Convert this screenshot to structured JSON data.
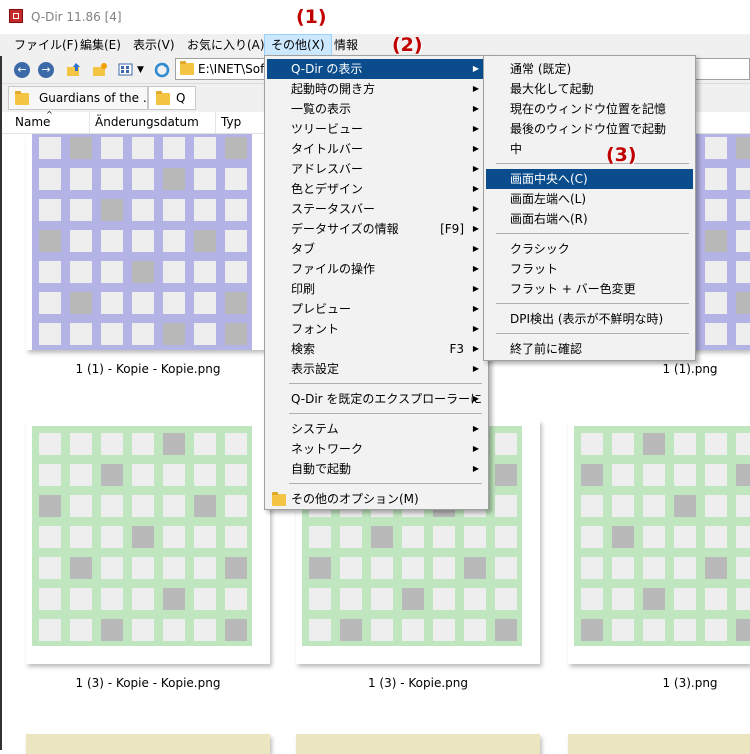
{
  "window": {
    "title": "Q-Dir 11.86 [4]"
  },
  "menubar": [
    {
      "label": "ファイル(F)"
    },
    {
      "label": "編集(E)"
    },
    {
      "label": "表示(V)"
    },
    {
      "label": "お気に入り(A)"
    },
    {
      "label": "その他(X)",
      "active": true
    },
    {
      "label": "情報"
    }
  ],
  "toolbar": {
    "address": "E:\\INET\\Soft"
  },
  "tabs": [
    {
      "label": "Guardians of the ..."
    },
    {
      "label": "Q"
    }
  ],
  "columns": [
    {
      "label": "Name"
    },
    {
      "label": "Änderungsdatum"
    },
    {
      "label": "Typ"
    }
  ],
  "files": [
    {
      "caption": "1 (1) - Kopie - Kopie.png",
      "color": "#b3b3e6"
    },
    {
      "caption": "1 (1).png",
      "color": "#b3b3e6"
    },
    {
      "caption": "1 (3) - Kopie - Kopie.png",
      "color": "#bfe6bf"
    },
    {
      "caption": "1 (3) - Kopie.png",
      "color": "#bfe6bf"
    },
    {
      "caption": "1 (3).png",
      "color": "#bfe6bf"
    }
  ],
  "main_menu": [
    {
      "label": "Q-Dir の表示",
      "submenu": true,
      "highlight": true
    },
    {
      "label": "起動時の開き方",
      "submenu": true
    },
    {
      "label": "一覧の表示",
      "submenu": true
    },
    {
      "label": "ツリービュー",
      "submenu": true
    },
    {
      "label": "タイトルバー",
      "submenu": true
    },
    {
      "label": "アドレスバー",
      "submenu": true
    },
    {
      "label": "色とデザイン",
      "submenu": true
    },
    {
      "label": "ステータスバー",
      "submenu": true
    },
    {
      "label": "データサイズの情報",
      "shortcut": "[F9]",
      "submenu": true
    },
    {
      "label": "タブ",
      "submenu": true
    },
    {
      "label": "ファイルの操作",
      "submenu": true
    },
    {
      "label": "印刷",
      "submenu": true
    },
    {
      "label": "プレビュー",
      "submenu": true
    },
    {
      "label": "フォント",
      "submenu": true
    },
    {
      "label": "検索",
      "shortcut": "F3",
      "submenu": true
    },
    {
      "label": "表示設定",
      "submenu": true
    },
    {
      "label": "Q-Dir を既定のエクスプローラーに",
      "submenu": true,
      "sep_before": true
    },
    {
      "label": "システム",
      "submenu": true,
      "sep_before": true
    },
    {
      "label": "ネットワーク",
      "submenu": true
    },
    {
      "label": "自動で起動",
      "submenu": true
    },
    {
      "label": "その他のオプション(M)",
      "folder_icon": true,
      "sep_before": true
    }
  ],
  "sub_menu": [
    {
      "label": "通常 (既定)"
    },
    {
      "label": "最大化して起動"
    },
    {
      "label": "現在のウィンドウ位置を記憶"
    },
    {
      "label": "最後のウィンドウ位置で起動"
    },
    {
      "label": "中"
    },
    {
      "label": "画面中央へ(C)",
      "highlight": true,
      "sep_before": true
    },
    {
      "label": "画面左端へ(L)"
    },
    {
      "label": "画面右端へ(R)"
    },
    {
      "label": "クラシック",
      "sep_before": true
    },
    {
      "label": "フラット"
    },
    {
      "label": "フラット + バー色変更"
    },
    {
      "label": "DPI検出 (表示が不鮮明な時)",
      "sep_before": true
    },
    {
      "label": "終了前に確認",
      "sep_before": true
    }
  ],
  "annotations": [
    "(1)",
    "(2)",
    "(3)"
  ],
  "colors": {
    "highlight": "#0a4c8c",
    "annotation": "#c00000",
    "menu_bg": "#f2f2f2"
  }
}
